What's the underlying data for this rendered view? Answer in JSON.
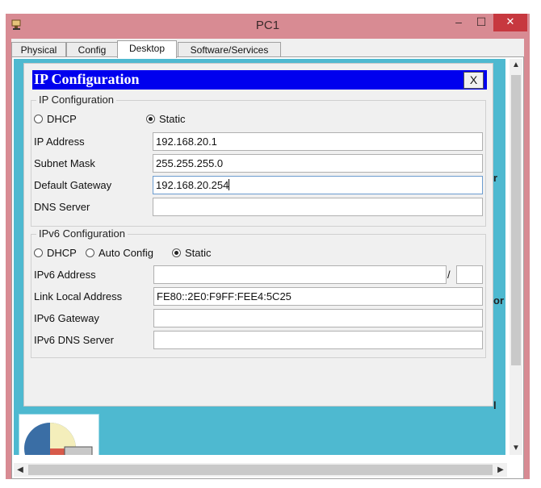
{
  "window": {
    "title": "PC1",
    "min_label": "–",
    "max_label": "☐",
    "close_label": "✕"
  },
  "tabs": [
    "Physical",
    "Config",
    "Desktop",
    "Software/Services"
  ],
  "active_tab": "Desktop",
  "desktop_peek": {
    "text_right_1": "r",
    "text_right_2": "or",
    "text_right_3": "l"
  },
  "dialog": {
    "title": "IP Configuration",
    "close_label": "X",
    "ipv4": {
      "group_label": "IP Configuration",
      "mode_options": [
        "DHCP",
        "Static"
      ],
      "mode_selected": "Static",
      "labels": {
        "ip": "IP Address",
        "mask": "Subnet Mask",
        "gateway": "Default Gateway",
        "dns": "DNS Server"
      },
      "values": {
        "ip": "192.168.20.1",
        "mask": "255.255.255.0",
        "gateway": "192.168.20.254",
        "dns": ""
      }
    },
    "ipv6": {
      "group_label": "IPv6 Configuration",
      "mode_options": [
        "DHCP",
        "Auto Config",
        "Static"
      ],
      "mode_selected": "Static",
      "labels": {
        "address": "IPv6 Address",
        "link_local": "Link Local Address",
        "gateway": "IPv6 Gateway",
        "dns": "IPv6 DNS Server"
      },
      "values": {
        "address": "",
        "prefix": "",
        "link_local": "FE80::2E0:F9FF:FEE4:5C25",
        "gateway": "",
        "dns": ""
      },
      "prefix_separator": "/"
    }
  },
  "scrollbars": {
    "up": "▲",
    "down": "▼",
    "left": "◀",
    "right": "▶"
  },
  "colors": {
    "titlebar": "#d88b93",
    "close": "#c7383f",
    "dialog_title": "#0000ee",
    "desktop": "#4eb9d0"
  }
}
